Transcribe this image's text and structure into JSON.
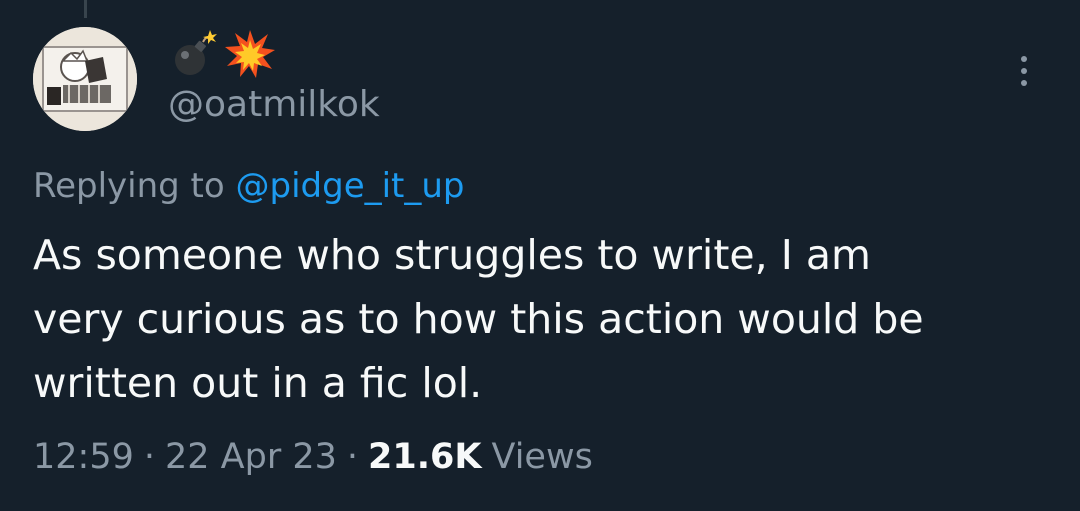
{
  "tweet": {
    "display_name_icons": [
      "bomb-icon",
      "collision-icon"
    ],
    "handle": "@oatmilkok",
    "replying_prefix": "Replying to",
    "replying_to": "@pidge_it_up",
    "text": "As someone who struggles to write, I am\nvery curious as to how this action would be\nwritten out in a fic lol.",
    "time": "12:59",
    "separator": "·",
    "date": "22 Apr 23",
    "views_count": "21.6K",
    "views_label": "Views"
  },
  "colors": {
    "background": "#15202b",
    "text_primary": "#f7f9f9",
    "text_secondary": "#8b98a5",
    "link": "#1d9bf0"
  }
}
